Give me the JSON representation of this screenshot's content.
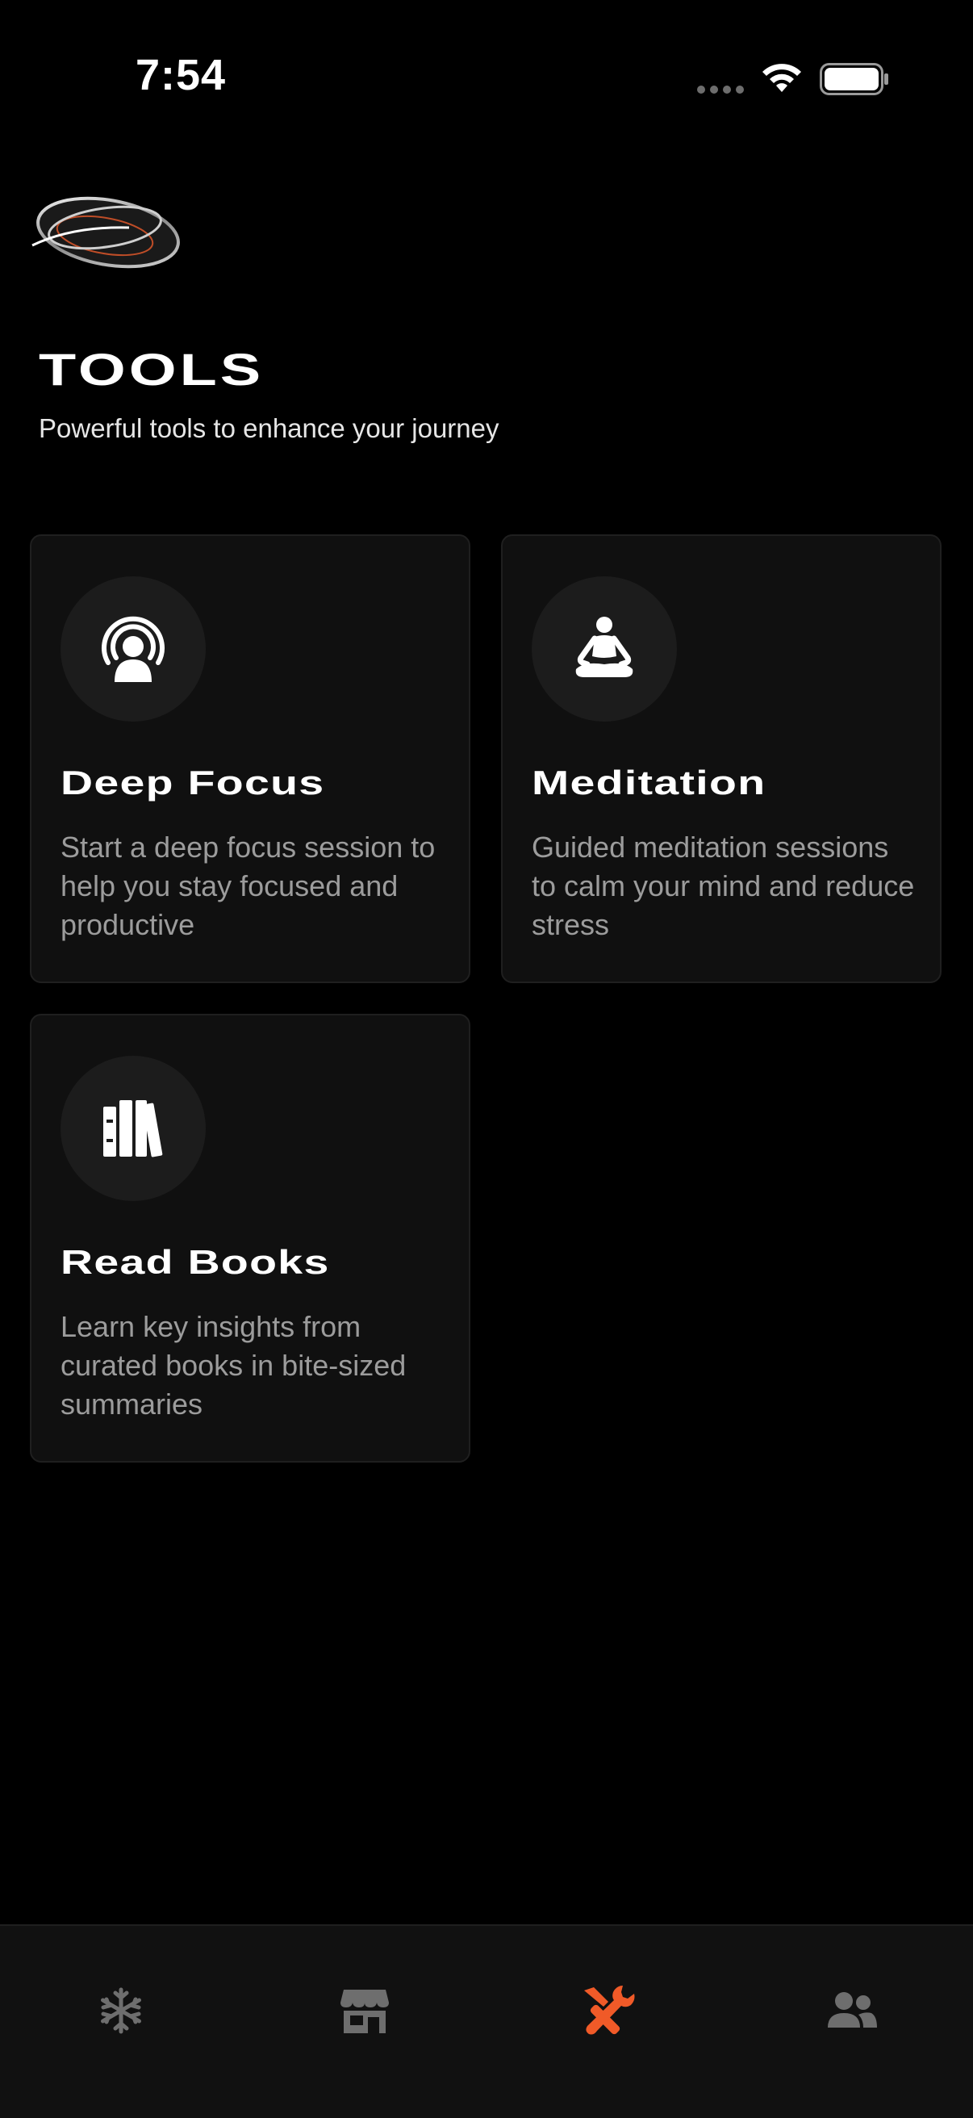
{
  "status_bar": {
    "time": "7:54",
    "signal_icon": "cellular-dots-icon",
    "wifi_icon": "wifi-icon",
    "battery_icon": "battery-icon"
  },
  "header": {
    "logo_icon": "ring-logo-icon",
    "title": "TOOLS",
    "subtitle": "Powerful tools to enhance your journey"
  },
  "tools": [
    {
      "icon": "focus-broadcast-icon",
      "title": "Deep Focus",
      "description": "Start a deep focus session to help you stay focused and productive"
    },
    {
      "icon": "meditation-icon",
      "title": "Meditation",
      "description": "Guided meditation sessions to calm your mind and reduce stress"
    },
    {
      "icon": "books-icon",
      "title": "Read Books",
      "description": "Learn key insights from curated books in bite-sized summaries"
    }
  ],
  "bottom_nav": {
    "items": [
      {
        "icon": "snowflake-icon",
        "active": false
      },
      {
        "icon": "store-icon",
        "active": false
      },
      {
        "icon": "tools-icon",
        "active": true
      },
      {
        "icon": "users-icon",
        "active": false
      }
    ],
    "active_color": "#f05a28",
    "inactive_color": "#6e6e6e"
  },
  "colors": {
    "background": "#000000",
    "card": "#101010",
    "accent": "#f05a28"
  }
}
